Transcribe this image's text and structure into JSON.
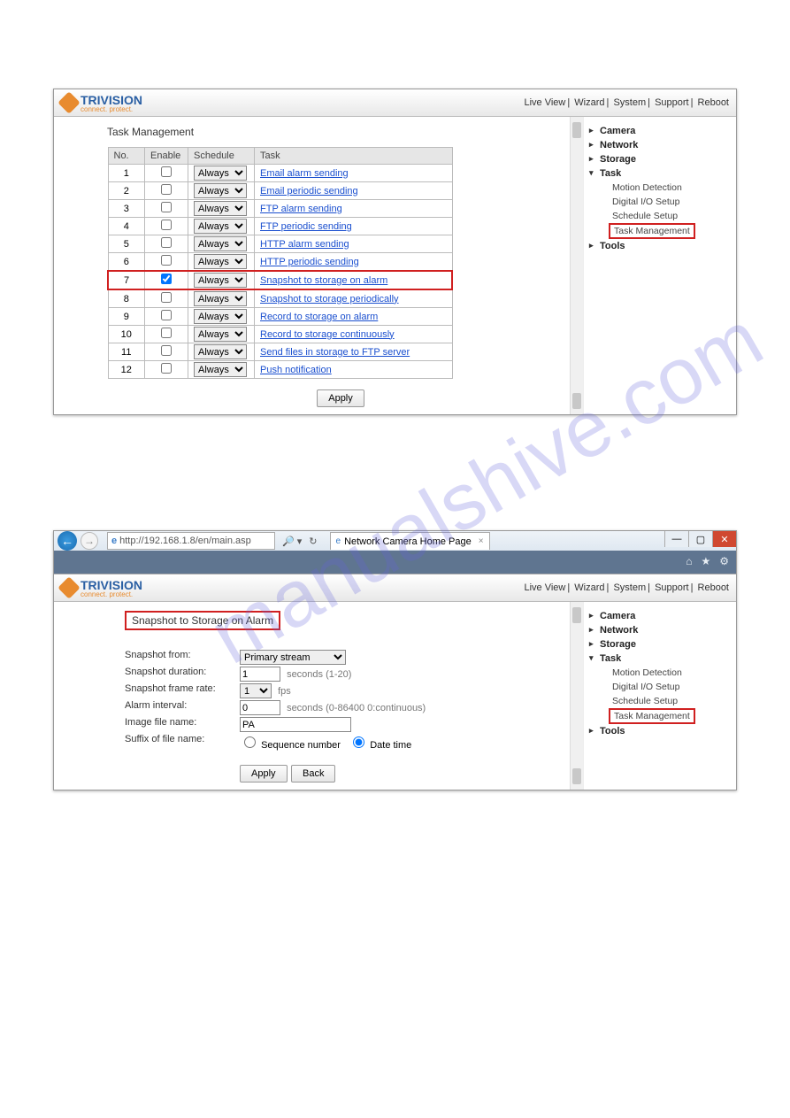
{
  "watermark": "manualshive.com",
  "logo": {
    "brand": "TRIVISION",
    "tagline": "connect. protect."
  },
  "topnav": [
    "Live View",
    "Wizard",
    "System",
    "Support",
    "Reboot"
  ],
  "sidebar": {
    "items": [
      {
        "label": "Camera"
      },
      {
        "label": "Network"
      },
      {
        "label": "Storage"
      },
      {
        "label": "Task",
        "expanded": true,
        "children": [
          {
            "label": "Motion Detection"
          },
          {
            "label": "Digital I/O Setup"
          },
          {
            "label": "Schedule Setup"
          },
          {
            "label": "Task Management",
            "highlight": true
          }
        ]
      },
      {
        "label": "Tools"
      }
    ]
  },
  "task_page": {
    "title": "Task Management",
    "headers": {
      "no": "No.",
      "enable": "Enable",
      "schedule": "Schedule",
      "task": "Task"
    },
    "schedule_option": "Always",
    "apply": "Apply",
    "rows": [
      {
        "no": "1",
        "enabled": false,
        "task": "Email alarm sending"
      },
      {
        "no": "2",
        "enabled": false,
        "task": "Email periodic sending"
      },
      {
        "no": "3",
        "enabled": false,
        "task": "FTP alarm sending"
      },
      {
        "no": "4",
        "enabled": false,
        "task": "FTP periodic sending"
      },
      {
        "no": "5",
        "enabled": false,
        "task": "HTTP alarm sending"
      },
      {
        "no": "6",
        "enabled": false,
        "task": "HTTP periodic sending"
      },
      {
        "no": "7",
        "enabled": true,
        "task": "Snapshot to storage on alarm",
        "highlight": true
      },
      {
        "no": "8",
        "enabled": false,
        "task": "Snapshot to storage periodically"
      },
      {
        "no": "9",
        "enabled": false,
        "task": "Record to storage on alarm"
      },
      {
        "no": "10",
        "enabled": false,
        "task": "Record to storage continuously"
      },
      {
        "no": "11",
        "enabled": false,
        "task": "Send files in storage to FTP server"
      },
      {
        "no": "12",
        "enabled": false,
        "task": "Push notification"
      }
    ]
  },
  "ie": {
    "url": "http://192.168.1.8/en/main.asp",
    "search_hint": "",
    "tab_title": "Network Camera Home Page",
    "win_min": "—",
    "win_max": "▢",
    "win_close": "✕"
  },
  "snapshot_page": {
    "title": "Snapshot to Storage on Alarm",
    "fields": {
      "from_label": "Snapshot from:",
      "from_value": "Primary stream",
      "duration_label": "Snapshot duration:",
      "duration_value": "1",
      "duration_hint": "seconds (1-20)",
      "rate_label": "Snapshot frame rate:",
      "rate_value": "1",
      "rate_unit": "fps",
      "interval_label": "Alarm interval:",
      "interval_value": "0",
      "interval_hint": "seconds (0-86400 0:continuous)",
      "imgname_label": "Image file name:",
      "imgname_value": "PA",
      "suffix_label": "Suffix of file name:",
      "suffix_seq": "Sequence number",
      "suffix_dt": "Date time"
    },
    "apply": "Apply",
    "back": "Back"
  }
}
